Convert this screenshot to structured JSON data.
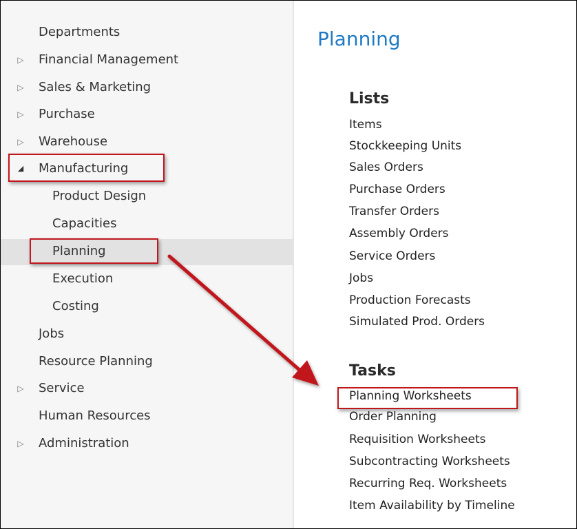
{
  "nav": {
    "items": [
      {
        "label": "Departments",
        "arrow": ""
      },
      {
        "label": "Financial Management",
        "arrow": "▷"
      },
      {
        "label": "Sales & Marketing",
        "arrow": "▷"
      },
      {
        "label": "Purchase",
        "arrow": "▷"
      },
      {
        "label": "Warehouse",
        "arrow": "▷"
      },
      {
        "label": "Manufacturing",
        "arrow": "◢"
      },
      {
        "label": "Product Design",
        "arrow": ""
      },
      {
        "label": "Capacities",
        "arrow": ""
      },
      {
        "label": "Planning",
        "arrow": ""
      },
      {
        "label": "Execution",
        "arrow": ""
      },
      {
        "label": "Costing",
        "arrow": ""
      },
      {
        "label": "Jobs",
        "arrow": ""
      },
      {
        "label": "Resource Planning",
        "arrow": ""
      },
      {
        "label": "Service",
        "arrow": "▷"
      },
      {
        "label": "Human Resources",
        "arrow": ""
      },
      {
        "label": "Administration",
        "arrow": "▷"
      }
    ]
  },
  "content": {
    "title": "Planning",
    "lists": {
      "heading": "Lists",
      "items": [
        "Items",
        "Stockkeeping Units",
        "Sales Orders",
        "Purchase Orders",
        "Transfer Orders",
        "Assembly Orders",
        "Service Orders",
        "Jobs",
        "Production Forecasts",
        "Simulated Prod. Orders"
      ]
    },
    "tasks": {
      "heading": "Tasks",
      "items": [
        "Planning Worksheets",
        "Order Planning",
        "Requisition Worksheets",
        "Subcontracting Worksheets",
        "Recurring Req. Worksheets",
        "Item Availability by Timeline"
      ]
    }
  },
  "colors": {
    "title_blue": "#1e7ac4",
    "annotation_red": "#c0161c",
    "selected_bg": "#e2e2e2",
    "pane_bg": "#f6f6f6"
  }
}
